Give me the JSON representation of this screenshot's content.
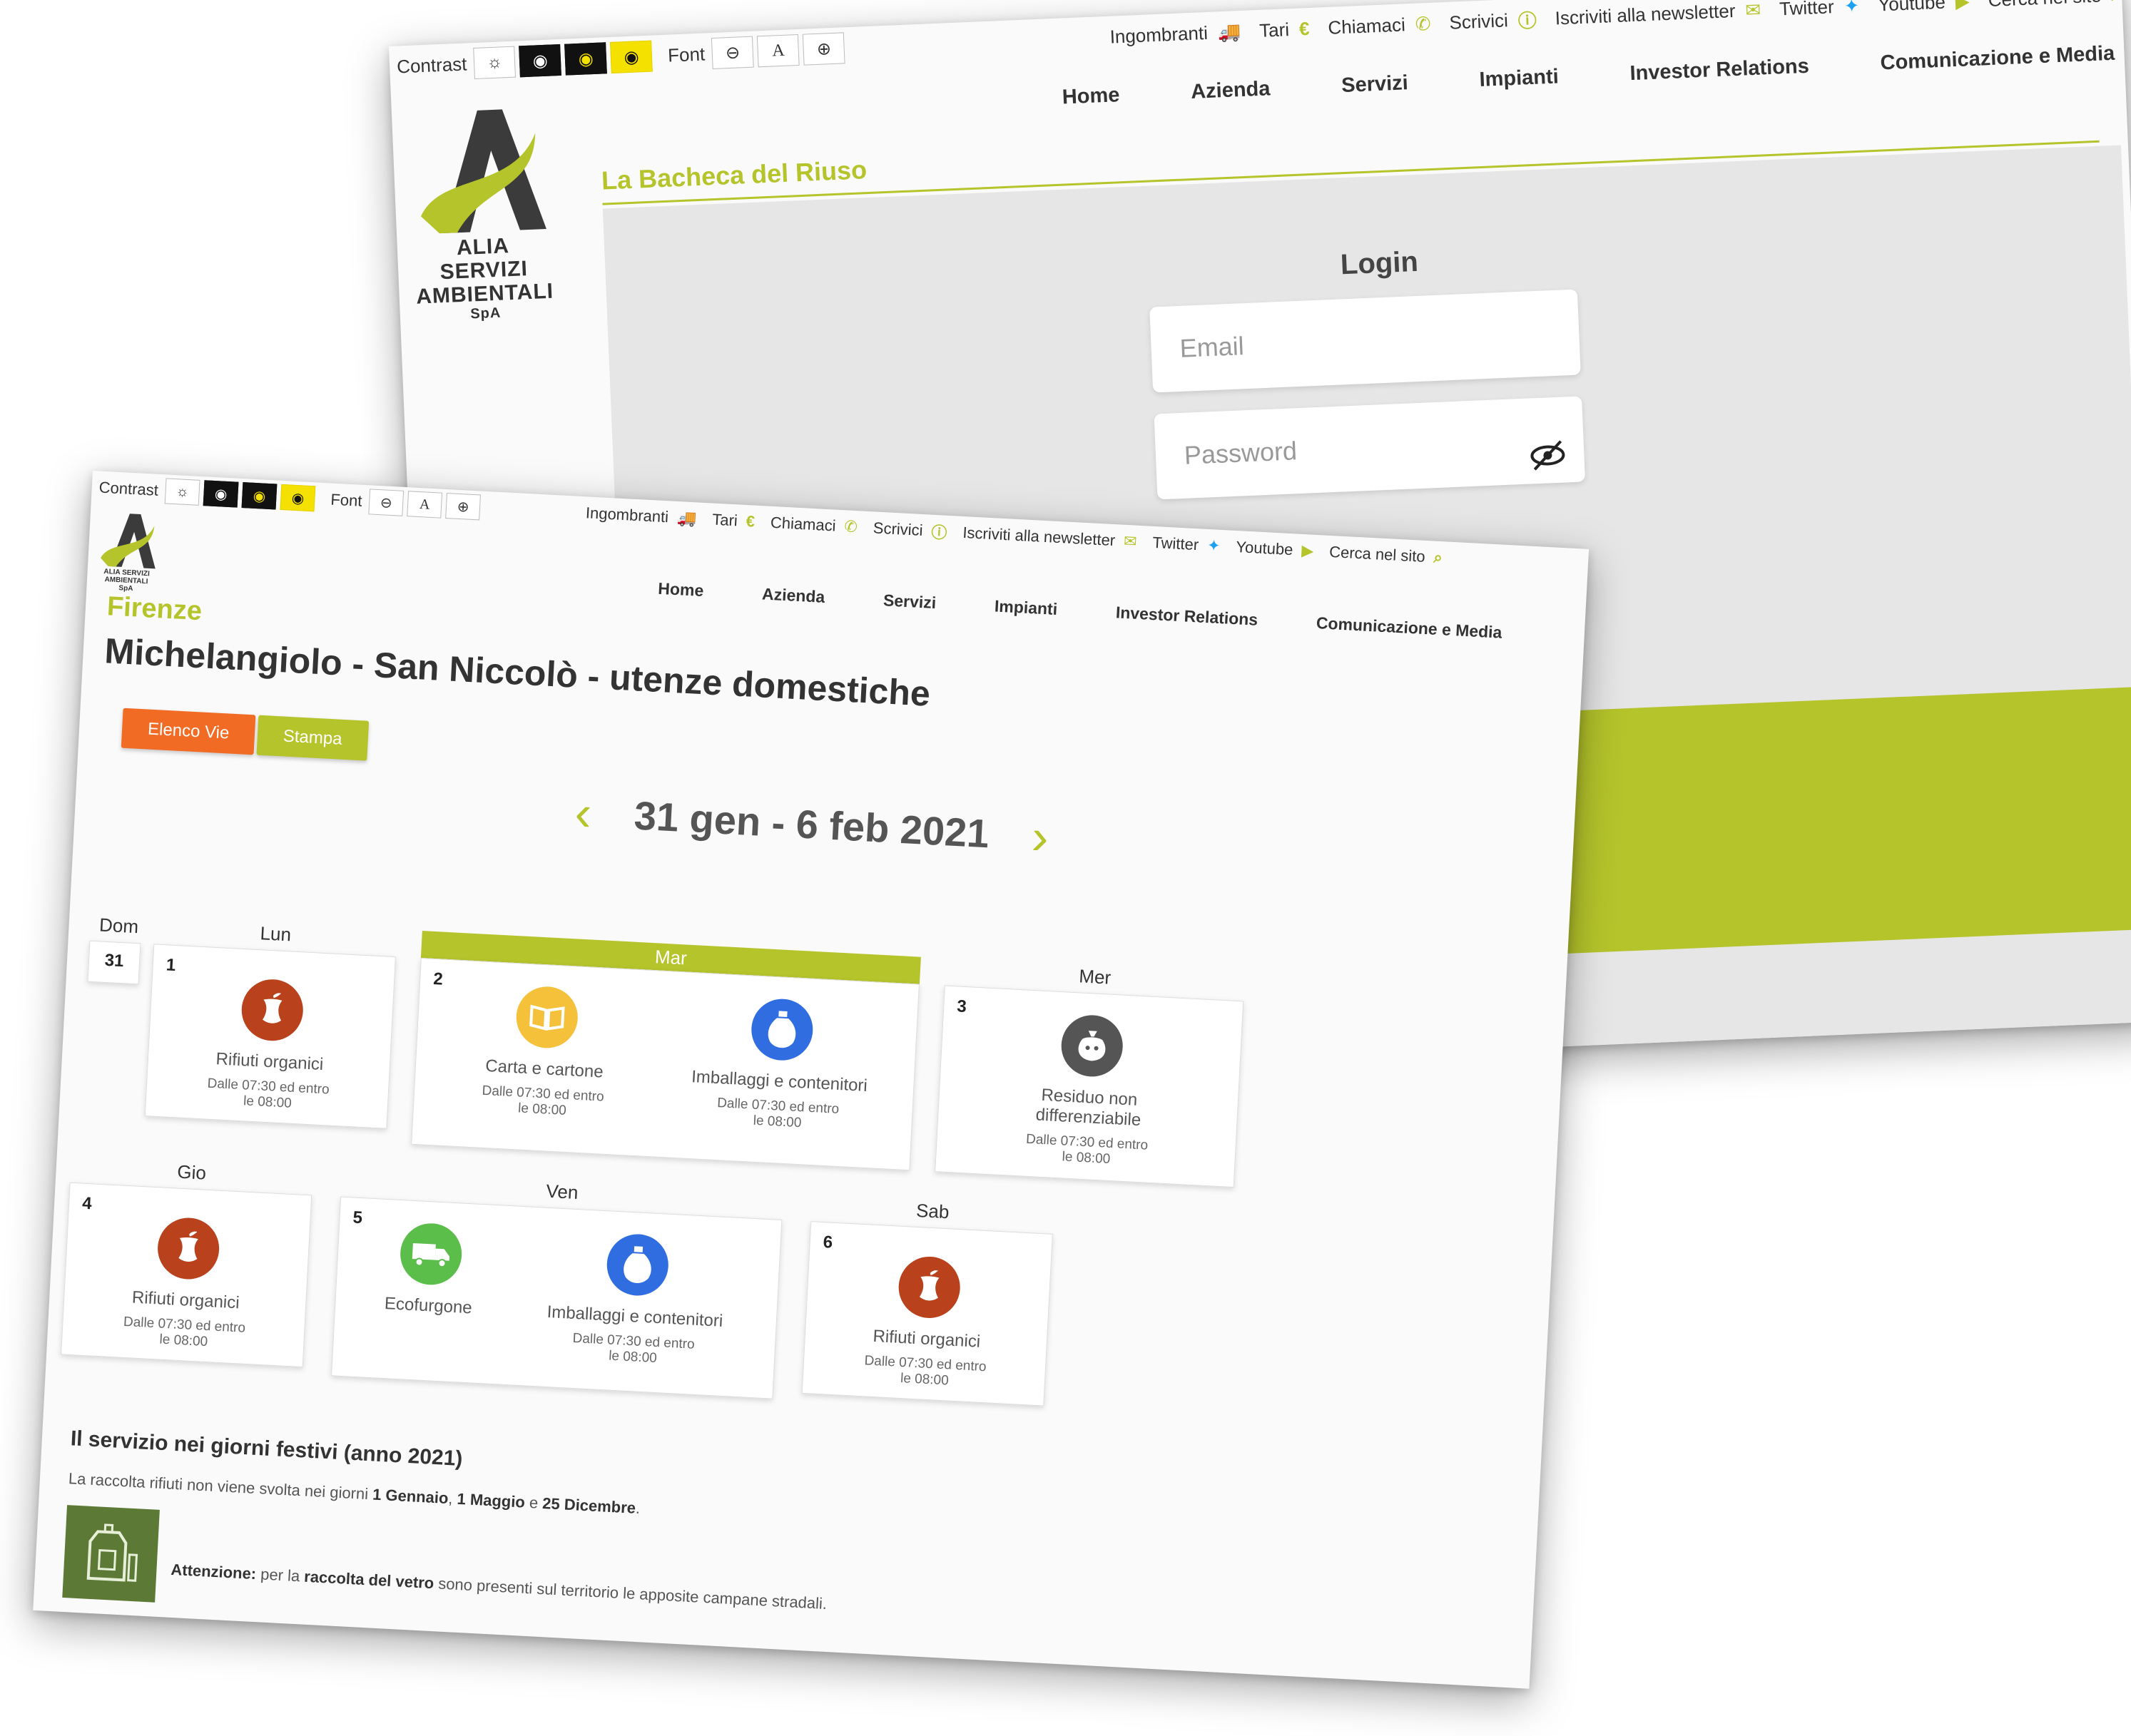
{
  "back": {
    "utility": {
      "contrast_label": "Contrast",
      "font_label": "Font",
      "font_a": "A",
      "links": [
        "Ingombranti",
        "Tari",
        "Chiamaci",
        "Scrivici",
        "Iscriviti alla newsletter",
        "Twitter",
        "Youtube",
        "Cerca nel sito"
      ]
    },
    "logo": {
      "line1": "ALIA SERVIZI",
      "line2": "AMBIENTALI",
      "line3": "SpA"
    },
    "nav": [
      "Home",
      "Azienda",
      "Servizi",
      "Impianti",
      "Investor Relations",
      "Comunicazione e Media"
    ],
    "section_title": "La Bacheca del Riuso",
    "login": {
      "title": "Login",
      "email_placeholder": "Email",
      "password_placeholder": "Password"
    }
  },
  "front": {
    "utility": {
      "contrast_label": "Contrast",
      "font_label": "Font",
      "font_a": "A",
      "links": [
        "Ingombranti",
        "Tari",
        "Chiamaci",
        "Scrivici",
        "Iscriviti alla newsletter",
        "Twitter",
        "Youtube",
        "Cerca nel sito"
      ]
    },
    "logo": {
      "line1": "ALIA SERVIZI",
      "line2": "AMBIENTALI",
      "line3": "SpA"
    },
    "nav": [
      "Home",
      "Azienda",
      "Servizi",
      "Impianti",
      "Investor Relations",
      "Comunicazione e Media"
    ],
    "city": "Firenze",
    "zone": "Michelangiolo - San Niccolò - utenze domestiche",
    "buttons": {
      "elenco_vie": "Elenco Vie",
      "stampa": "Stampa"
    },
    "week": {
      "label": "31 gen - 6 feb 2021",
      "prev": "‹",
      "next": "›"
    },
    "days": {
      "dom": {
        "name": "Dom",
        "num": "31"
      },
      "lun": {
        "name": "Lun",
        "num": "1"
      },
      "mar": {
        "name": "Mar",
        "num": "2"
      },
      "mer": {
        "name": "Mer",
        "num": "3"
      },
      "gio": {
        "name": "Gio",
        "num": "4"
      },
      "ven": {
        "name": "Ven",
        "num": "5"
      },
      "sab": {
        "name": "Sab",
        "num": "6"
      }
    },
    "services": {
      "organici": "Rifiuti organici",
      "carta": "Carta e cartone",
      "imballaggi": "Imballaggi e contenitori",
      "residuo": "Residuo non differenziabile",
      "ecofurgone": "Ecofurgone",
      "time_line1": "Dalle 07:30 ed entro",
      "time_line2": "le 08:00"
    },
    "festivi": {
      "title": "Il servizio nei giorni festivi (anno 2021)",
      "text_pre": "La raccolta rifiuti non viene svolta nei giorni ",
      "date1": "1 Gennaio",
      "sep1": ", ",
      "date2": "1 Maggio",
      "sep2": " e ",
      "date3": "25 Dicembre",
      "text_post": "."
    },
    "vetro": {
      "label": "Attenzione:",
      "text_pre": " per la ",
      "bold": "raccolta del vetro",
      "text_post": " sono presenti sul territorio le apposite campane stradali."
    }
  },
  "colors": {
    "brand_green": "#b5c42b",
    "orange": "#f26b25",
    "organic": "#b9421c",
    "paper": "#f5c13a",
    "packaging": "#2f6de0",
    "residual": "#555555",
    "ecovan": "#5bbd4a"
  },
  "icons": [
    "brightness-icon",
    "eye-icon",
    "minus-circle-icon",
    "plus-circle-icon",
    "truck-icon",
    "euro-icon",
    "phone-icon",
    "info-icon",
    "envelope-icon",
    "twitter-bird-icon",
    "youtube-icon",
    "search-icon",
    "eye-slash-icon",
    "chevron-left-icon",
    "chevron-right-icon",
    "apple-core-icon",
    "book-icon",
    "bottle-icon",
    "trash-bag-icon",
    "van-icon",
    "glass-bin-icon"
  ]
}
